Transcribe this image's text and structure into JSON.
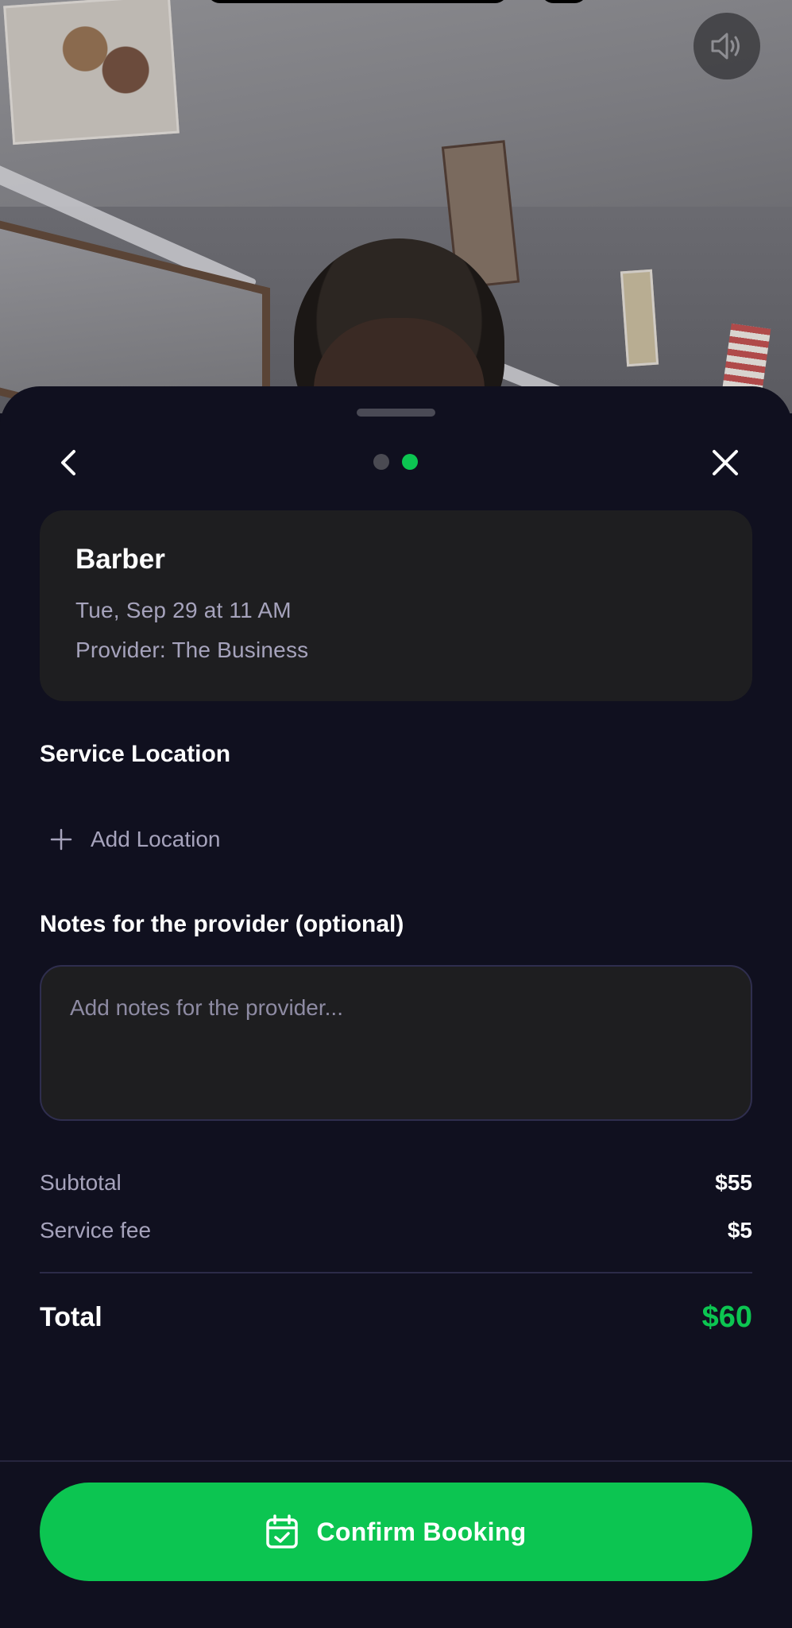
{
  "header": {
    "sound_icon": "speaker-icon",
    "back_icon": "chevron-left-icon",
    "close_icon": "close-icon",
    "page_dots": {
      "total": 2,
      "active_index": 1
    }
  },
  "summary": {
    "service_name": "Barber",
    "datetime": "Tue, Sep 29 at 11 AM",
    "provider": "Provider: The Business"
  },
  "location": {
    "heading": "Service Location",
    "add_label": "Add Location",
    "add_icon": "plus-icon"
  },
  "notes": {
    "heading": "Notes for the provider (optional)",
    "placeholder": "Add notes for the provider..."
  },
  "pricing": {
    "subtotal_label": "Subtotal",
    "subtotal_value": "$55",
    "fee_label": "Service fee",
    "fee_value": "$5",
    "total_label": "Total",
    "total_value": "$60"
  },
  "footer": {
    "confirm_label": "Confirm Booking",
    "confirm_icon": "calendar-check-icon"
  },
  "colors": {
    "accent": "#0cc551",
    "sheet_bg": "#10101f",
    "card_bg": "#1e1e20",
    "muted_text": "#a6a3bc"
  }
}
